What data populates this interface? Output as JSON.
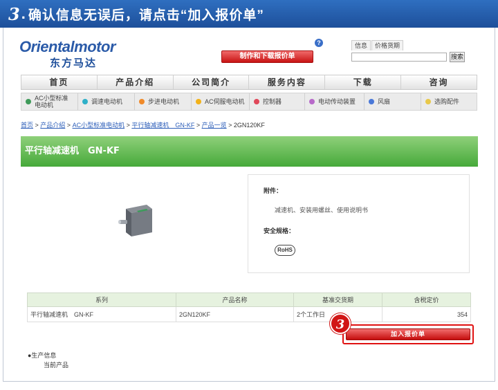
{
  "banner": {
    "step": "3",
    "text": "确认信息无误后，请点击“加入报价单”"
  },
  "header": {
    "logo_en": "Orientalmotor",
    "logo_cn": "东方马达",
    "download_button": "制作和下载报价单",
    "search_tabs": [
      "信息",
      "价格货期"
    ],
    "search_button": "搜索",
    "help_icon": "?"
  },
  "main_nav": [
    "首页",
    "产品介绍",
    "公司简介",
    "服务内容",
    "下载",
    "咨询"
  ],
  "sub_nav": [
    {
      "label": "AC小型标准\n电动机",
      "color": "#3f9a5a"
    },
    {
      "label": "调速电动机",
      "color": "#2fb0c8"
    },
    {
      "label": "步进电动机",
      "color": "#f08a2a"
    },
    {
      "label": "AC伺服电动机",
      "color": "#f2b21a"
    },
    {
      "label": "控制器",
      "color": "#e0485a"
    },
    {
      "label": "电动传动装置",
      "color": "#b769c9"
    },
    {
      "label": "风扇",
      "color": "#4a78d8"
    },
    {
      "label": "选购配件",
      "color": "#e8c84a"
    }
  ],
  "breadcrumb": {
    "links": [
      "首页",
      "产品介绍",
      "AC小型标准电动机",
      "平行轴减速机　GN-KF",
      "产品一览"
    ],
    "current": "2GN120KF"
  },
  "page_title": "平行轴减速机　GN-KF",
  "specs": {
    "accessory_label": "附件：",
    "accessory_text": "减速机、安装用螺丝、使用说明书",
    "safety_label": "安全规格：",
    "rohs": "RoHS"
  },
  "table": {
    "headers": [
      "系列",
      "产品名称",
      "基准交货期",
      "含税定价"
    ],
    "rows": [
      [
        "平行轴减速机　GN-KF",
        "2GN120KF",
        "2个工作日",
        "354"
      ]
    ]
  },
  "quote": {
    "badge": "3",
    "button": "加入报价单"
  },
  "production": {
    "label": "●生产信息",
    "value": "当前产品"
  }
}
